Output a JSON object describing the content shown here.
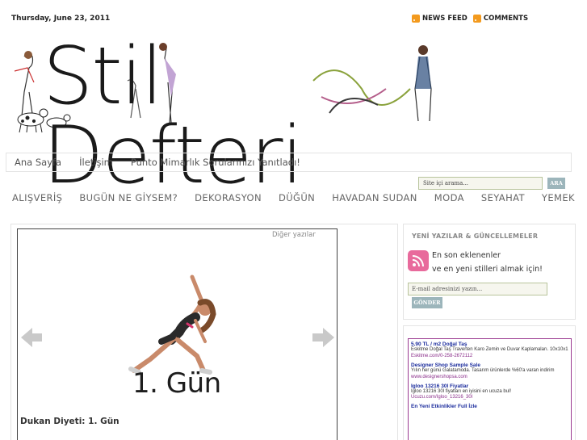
{
  "header": {
    "date": "Thursday, June 23, 2011",
    "feeds": [
      {
        "label": "NEWS FEED",
        "icon": "rss-icon"
      },
      {
        "label": "COMMENTS",
        "icon": "rss-icon"
      }
    ],
    "logo_text": "Stil Defteri"
  },
  "nav_pages": [
    "Ana Sayfa",
    "İletişim",
    "Punto Mimarlık Sorularınızı Yanıtladı!"
  ],
  "search": {
    "placeholder": "Site içi arama...",
    "button": "ARA"
  },
  "nav_categories": [
    "ALIŞVERİŞ",
    "BUGÜN NE GİYSEM?",
    "DEKORASYON",
    "DÜĞÜN",
    "HAVADAN SUDAN",
    "MODA",
    "SEYAHAT",
    "YEMEK"
  ],
  "slider": {
    "other_posts": "Diğer yazılar",
    "image_caption": "1. Gün",
    "post_title": "Dukan Diyeti: 1. Gün"
  },
  "sidebar": {
    "subscribe_title": "YENİ YAZILAR & GÜNCELLEMELER",
    "line1": "En son eklenenler",
    "line2": "ve en yeni stilleri almak için!",
    "email_placeholder": "E-mail adresinizi yazın...",
    "submit": "GÖNDER"
  },
  "ads": [
    {
      "title": "5.90 TL / m2 Doğal Taş",
      "body": "Eskitme Doğal Taş Traverten Karo Zemin ve Duvar Kaplamaları. 10x10x1",
      "url": "Eskitme.com/0-258-2672112"
    },
    {
      "title": "Designer Shop Sample Sale",
      "body": "Yılın her günü Galatamoda. Tasarım ürünlerde %60'a varan indirim",
      "url": "www.designershopsa.com"
    },
    {
      "title": "Igloo 13216 30l Fiyatlar",
      "body": "Igloo 13216 30l fiyatları en iyisini en ucuza bul!",
      "url": "Ucuzu.com/Igloo_13216_30l"
    },
    {
      "title": "En Yeni Etkinlikler Full İzle",
      "body": "",
      "url": ""
    }
  ],
  "colors": {
    "rss": "#f39a1e",
    "button": "#9cb5bb",
    "ad_border": "#9c3c92",
    "ad_title": "#1a2b9c"
  }
}
